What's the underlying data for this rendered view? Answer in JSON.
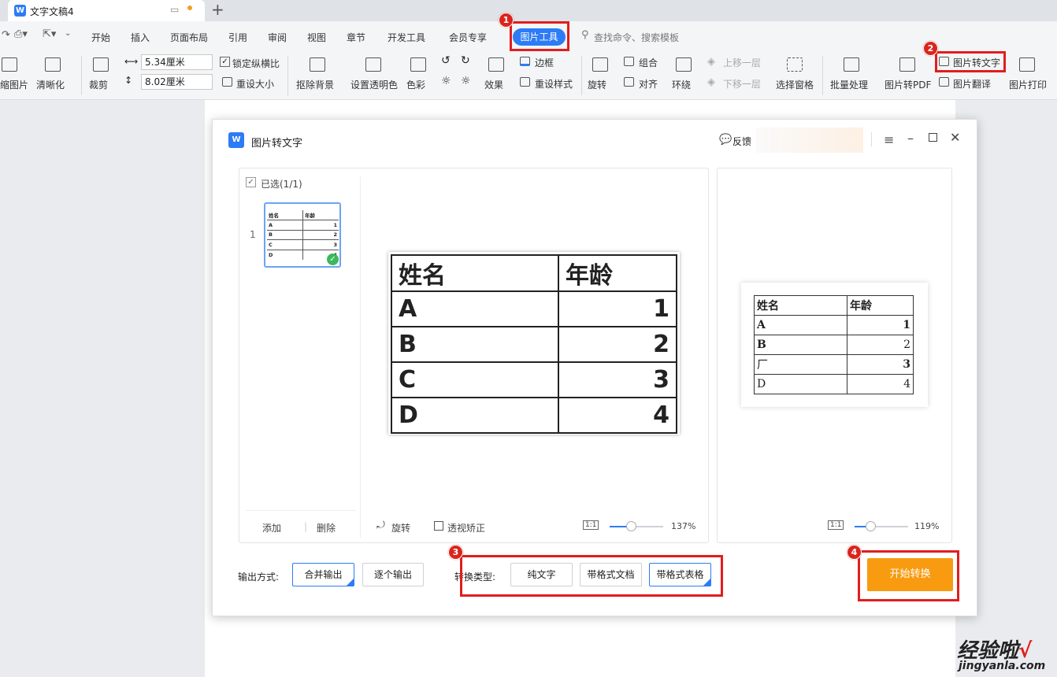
{
  "titlebar": {
    "doc_title": "文字文稿4",
    "add_tab": "+"
  },
  "menu": {
    "items": [
      "开始",
      "插入",
      "页面布局",
      "引用",
      "审阅",
      "视图",
      "章节",
      "开发工具",
      "会员专享"
    ],
    "active_tab": "图片工具",
    "search_placeholder": "查找命令、搜索模板"
  },
  "ribbon": {
    "compress": "缩图片",
    "sharpen": "清晰化",
    "crop": "裁剪",
    "width": "5.34厘米",
    "height": "8.02厘米",
    "lock_ratio": "锁定纵横比",
    "reset_size": "重设大小",
    "remove_bg": "抠除背景",
    "transparent": "设置透明色",
    "color": "色彩",
    "effects": "效果",
    "border": "边框",
    "reset_style": "重设样式",
    "rotate": "旋转",
    "group": "组合",
    "align": "对齐",
    "wrap": "环绕",
    "bring_forward": "上移一层",
    "send_backward": "下移一层",
    "selection_pane": "选择窗格",
    "batch": "批量处理",
    "to_pdf": "图片转PDF",
    "to_text": "图片转文字",
    "translate": "图片翻译",
    "print": "图片打印"
  },
  "dialog": {
    "title": "图片转文字",
    "feedback": "反馈",
    "selected": "已选(1/1)",
    "thumb_index": "1",
    "add": "添加",
    "delete": "删除",
    "rotate": "旋转",
    "perspective": "透视矫正",
    "zoom_left": "137%",
    "zoom_right": "119%",
    "zoom_left_pct": 40,
    "zoom_right_pct": 30,
    "actual_size_icon": "1:1",
    "output_label": "输出方式:",
    "output_merge": "合并输出",
    "output_each": "逐个输出",
    "type_label": "转换类型:",
    "type_plain": "纯文字",
    "type_doc": "带格式文档",
    "type_table": "带格式表格",
    "start": "开始转换"
  },
  "source_table": {
    "header": [
      "姓名",
      "年龄"
    ],
    "rows": [
      [
        "A",
        "1"
      ],
      [
        "B",
        "2"
      ],
      [
        "C",
        "3"
      ],
      [
        "D",
        "4"
      ]
    ]
  },
  "result_table": {
    "header": [
      "姓名",
      "年龄"
    ],
    "rows": [
      [
        "A",
        "1"
      ],
      [
        "B",
        "2"
      ],
      [
        "厂",
        "3"
      ],
      [
        "D",
        "4"
      ]
    ]
  },
  "badges": [
    "1",
    "2",
    "3",
    "4"
  ],
  "watermark": {
    "text": "经验啦",
    "check": "√",
    "url": "jingyanla.com"
  },
  "colors": {
    "accent": "#2d7cf6",
    "start_button": "#f99b10",
    "highlight": "#e21d1d"
  }
}
